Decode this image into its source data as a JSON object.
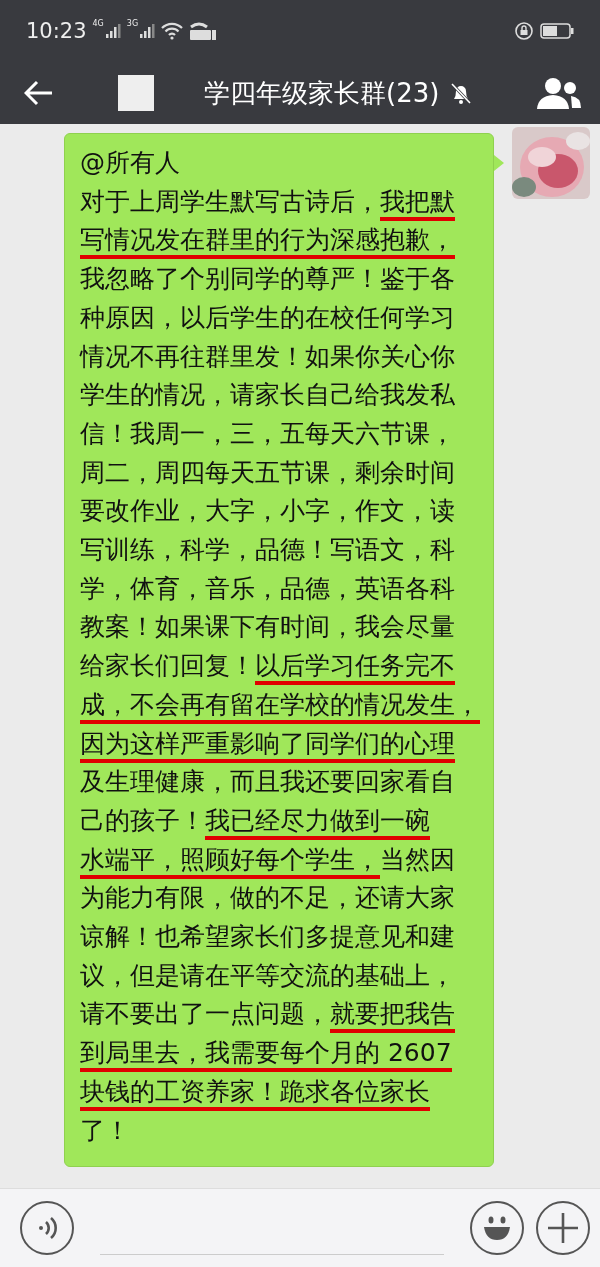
{
  "status_bar": {
    "time": "10:23",
    "networks": [
      "4G",
      "3G"
    ]
  },
  "title_bar": {
    "title": "学四年级家长群(23)",
    "muted": true
  },
  "message": {
    "from_me": true,
    "avatar": {
      "kind": "picture"
    },
    "lines": [
      [
        {
          "text": "@所有人",
          "underlined": false
        }
      ],
      [
        {
          "text": "对于上周学生默写古诗后，",
          "underlined": false
        },
        {
          "text": "我把默",
          "underlined": true
        }
      ],
      [
        {
          "text": "写情况发在群里的行为深感抱歉，",
          "underlined": true
        }
      ],
      [
        {
          "text": "我忽略了个别同学的尊严！鉴于各",
          "underlined": false
        }
      ],
      [
        {
          "text": "种原因，以后学生的在校任何学习",
          "underlined": false
        }
      ],
      [
        {
          "text": "情况不再往群里发！如果你关心你",
          "underlined": false
        }
      ],
      [
        {
          "text": "学生的情况，请家长自己给我发私",
          "underlined": false
        }
      ],
      [
        {
          "text": "信！我周一，三，五每天六节课，",
          "underlined": false
        }
      ],
      [
        {
          "text": "周二，周四每天五节课，剩余时间",
          "underlined": false
        }
      ],
      [
        {
          "text": "要改作业，大字，小字，作文，读",
          "underlined": false
        }
      ],
      [
        {
          "text": "写训练，科学，品德！写语文，科",
          "underlined": false
        }
      ],
      [
        {
          "text": "学，体育，音乐，品德，英语各科",
          "underlined": false
        }
      ],
      [
        {
          "text": "教案！如果课下有时间，我会尽量",
          "underlined": false
        }
      ],
      [
        {
          "text": "给家长们回复！",
          "underlined": false
        },
        {
          "text": "以后学习任务完不",
          "underlined": true
        }
      ],
      [
        {
          "text": "成，不会再有留在学校的情况发生，",
          "underlined": true
        }
      ],
      [
        {
          "text": "因为这样严重影响了同学们的心理",
          "underlined": true
        }
      ],
      [
        {
          "text": "及生理健康，而且我还要回家看自",
          "underlined": false
        }
      ],
      [
        {
          "text": "己的孩子！",
          "underlined": false
        },
        {
          "text": "我已经尽力做到一碗",
          "underlined": true
        }
      ],
      [
        {
          "text": "水端平，照顾好每个学生，",
          "underlined": true
        },
        {
          "text": "当然因",
          "underlined": false
        }
      ],
      [
        {
          "text": "为能力有限，做的不足，还请大家",
          "underlined": false
        }
      ],
      [
        {
          "text": "谅解！也希望家长们多提意见和建",
          "underlined": false
        }
      ],
      [
        {
          "text": "议，但是请在平等交流的基础上，",
          "underlined": false
        }
      ],
      [
        {
          "text": "请不要出了一点问题，",
          "underlined": false
        },
        {
          "text": "就要把我告",
          "underlined": true
        }
      ],
      [
        {
          "text": "到局里去，我需要每个月的 2607",
          "underlined": true
        }
      ],
      [
        {
          "text": "块钱的工资养家！跪求各位家长",
          "underlined": true
        }
      ],
      [
        {
          "text": "了！",
          "underlined": false
        }
      ]
    ]
  }
}
